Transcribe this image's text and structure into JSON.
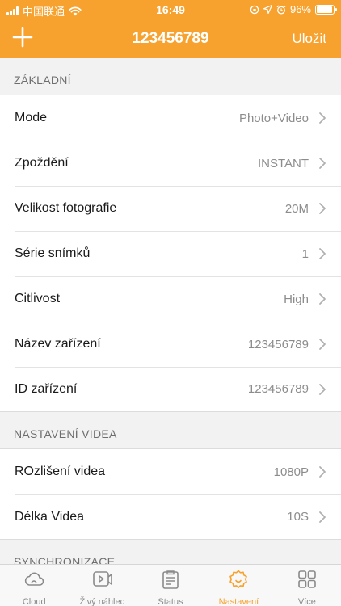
{
  "statusbar": {
    "carrier": "中国联通",
    "time": "16:49",
    "battery": "96%",
    "battery_level": 0.96
  },
  "nav": {
    "title": "123456789",
    "save_label": "Uložit"
  },
  "sections": [
    {
      "header": "ZÁKLADNÍ",
      "rows": [
        {
          "label": "Mode",
          "value": "Photo+Video"
        },
        {
          "label": "Zpoždění",
          "value": "INSTANT"
        },
        {
          "label": "Velikost fotografie",
          "value": "20M"
        },
        {
          "label": "Série snímků",
          "value": "1"
        },
        {
          "label": "Citlivost",
          "value": "High"
        },
        {
          "label": "Název zařízení",
          "value": "123456789"
        },
        {
          "label": "ID zařízení",
          "value": "123456789"
        }
      ]
    },
    {
      "header": "NASTAVENÍ VIDEA",
      "rows": [
        {
          "label": "ROzlišení videa",
          "value": "1080P"
        },
        {
          "label": "Délka Videa",
          "value": "10S"
        }
      ]
    },
    {
      "header": "SYNCHRONIZACE",
      "rows": []
    }
  ],
  "tabs": [
    {
      "label": "Cloud",
      "icon": "cloud-icon"
    },
    {
      "label": "Živý náhled",
      "icon": "video-play-icon"
    },
    {
      "label": "Status",
      "icon": "clipboard-icon"
    },
    {
      "label": "Nastavení",
      "icon": "settings-gear-icon",
      "active": true
    },
    {
      "label": "Více",
      "icon": "grid-apps-icon"
    }
  ],
  "colors": {
    "accent": "#f7a22e",
    "inactive": "#8a8a8a"
  }
}
